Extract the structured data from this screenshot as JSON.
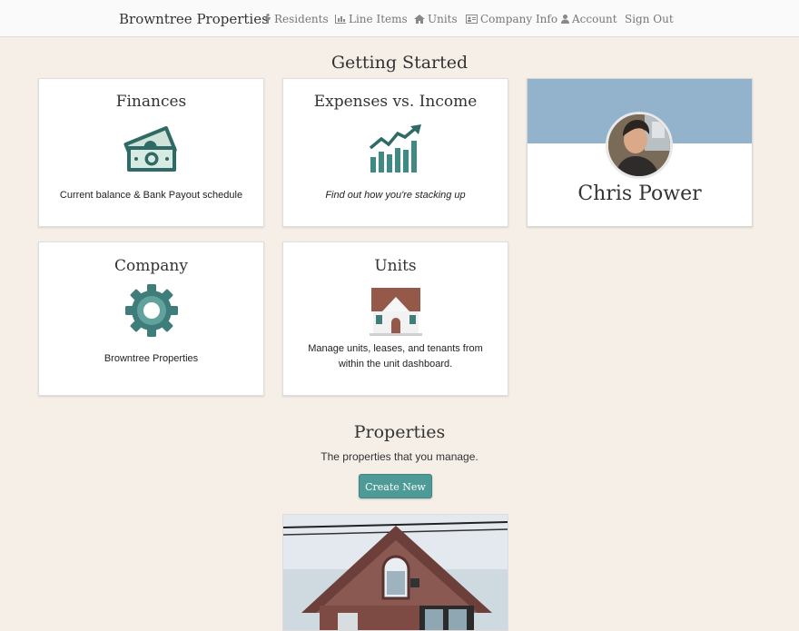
{
  "nav": {
    "brand": "Browntree Properties",
    "items": [
      {
        "label": "Residents",
        "icon": "person-icon"
      },
      {
        "label": "Line Items",
        "icon": "bar-chart-icon"
      },
      {
        "label": "Units",
        "icon": "home-icon"
      },
      {
        "label": "Company Info",
        "icon": "id-card-icon"
      },
      {
        "label": "Account",
        "icon": "user-icon"
      },
      {
        "label": "Sign Out",
        "icon": ""
      }
    ]
  },
  "getting_started": {
    "title": "Getting Started",
    "cards": [
      {
        "title": "Finances",
        "description": "Current balance & Bank Payout schedule",
        "icon": "money-icon"
      },
      {
        "title": "Expenses vs. Income",
        "description": "Find out how you're stacking up",
        "icon": "growth-chart-icon"
      },
      {
        "title": "Company",
        "description": "Browntree Properties",
        "icon": "gear-icon"
      },
      {
        "title": "Units",
        "description": "Manage units, leases, and tenants from within the unit dashboard.",
        "icon": "house-icon"
      }
    ],
    "profile": {
      "name": "Chris Power"
    }
  },
  "properties": {
    "title": "Properties",
    "subtitle": "The properties that you manage.",
    "create_button": "Create New"
  },
  "colors": {
    "background": "#f5efe7",
    "accent": "#4e9a96",
    "profile_banner": "#93b3cc",
    "icon_teal": "#3f7d7a"
  }
}
